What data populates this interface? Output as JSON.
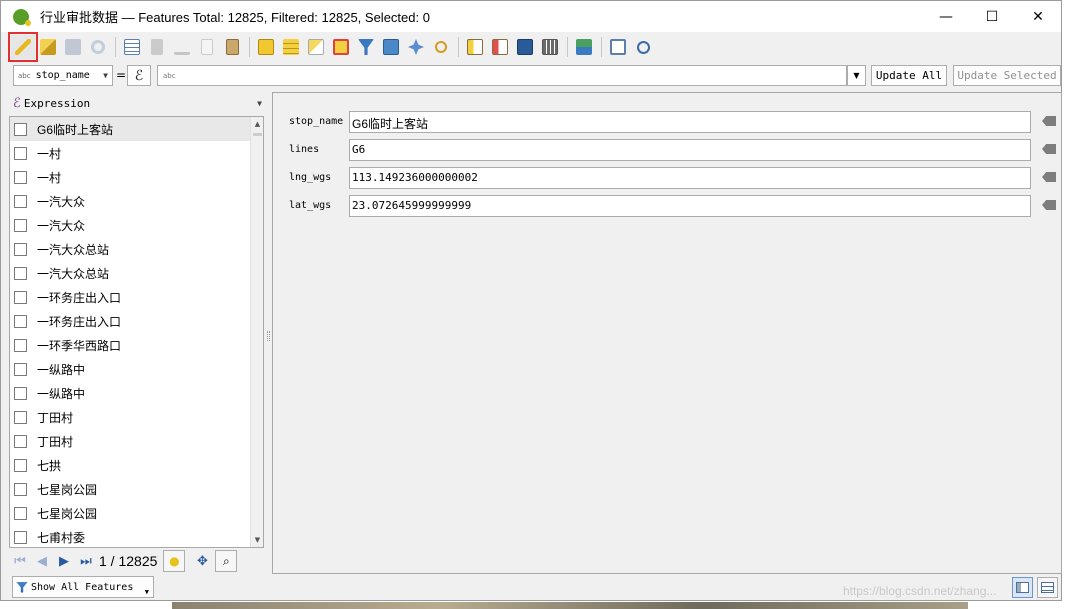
{
  "window": {
    "title": "行业审批数据 — Features Total: 12825, Filtered: 12825, Selected: 0",
    "minimize": "—",
    "maximize": "☐",
    "close": "✕"
  },
  "expression_bar": {
    "field_type": "abc",
    "field": "stop_name",
    "operator": "=",
    "value_type": "abc",
    "update_all": "Update All",
    "update_selected": "Update Selected"
  },
  "list": {
    "header": "Expression",
    "items": [
      "G6临时上客站",
      "一村",
      "一村",
      "一汽大众",
      "一汽大众",
      "一汽大众总站",
      "一汽大众总站",
      "一环务庄出入口",
      "一环务庄出入口",
      "一环季华西路口",
      "一纵路中",
      "一纵路中",
      "丁田村",
      "丁田村",
      "七拱",
      "七星岗公园",
      "七星岗公园",
      "七甫村委"
    ],
    "selected_index": 0
  },
  "navigation": {
    "current": "1",
    "total": "12825",
    "page_text": "1 / 12825",
    "show_all": "Show All Features"
  },
  "form": {
    "fields": [
      {
        "label": "stop_name",
        "value": "G6临时上客站"
      },
      {
        "label": "lines",
        "value": "G6"
      },
      {
        "label": "lng_wgs",
        "value": "113.149236000000002"
      },
      {
        "label": "lat_wgs",
        "value": "23.072645999999999"
      }
    ]
  },
  "watermark": "https://blog.csdn.net/zhang..."
}
